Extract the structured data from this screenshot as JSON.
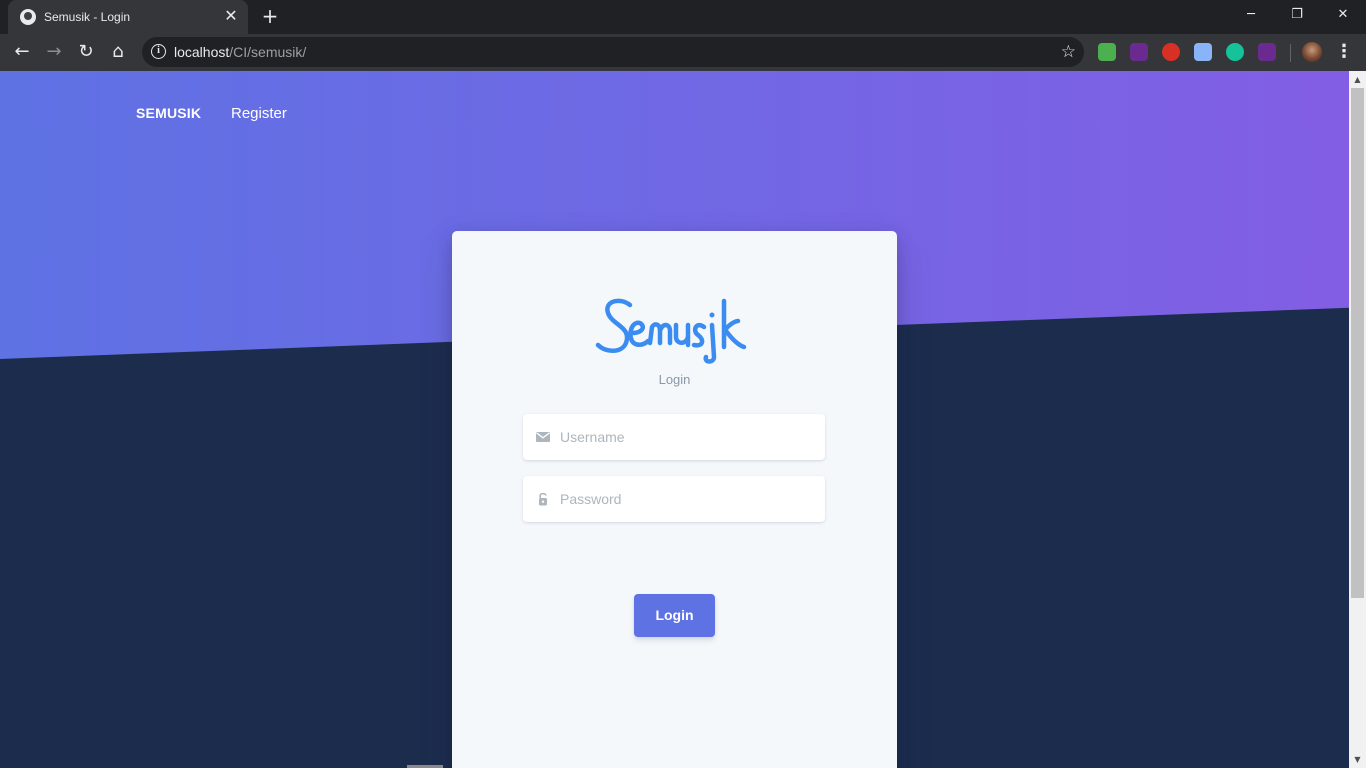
{
  "browser": {
    "tab_title": "Semusik - Login",
    "tab_close": "✕",
    "new_tab": "+",
    "url_host": "localhost",
    "url_path": "/CI/semusik/",
    "window": {
      "minimize": "─",
      "restore": "❐",
      "close": "✕"
    },
    "nav": {
      "back": "←",
      "forward": "→",
      "reload": "↻",
      "home": "⌂"
    },
    "star": "☆",
    "menu": "⋮",
    "extensions": [
      {
        "name": "ext-green-globe",
        "color": "#4caf50"
      },
      {
        "name": "ext-purple-x",
        "color": "#6b2a8f"
      },
      {
        "name": "ext-red-stop",
        "color": "#d93025"
      },
      {
        "name": "ext-owl",
        "color": "#8ab4f8"
      },
      {
        "name": "ext-grammarly",
        "color": "#15c39a"
      },
      {
        "name": "ext-purple-x-2",
        "color": "#6b2a8f"
      }
    ]
  },
  "navbar": {
    "brand": "SEMUSIK",
    "register": "Register"
  },
  "card": {
    "subtitle": "Login",
    "username_placeholder": "Username",
    "password_placeholder": "Password",
    "login_button": "Login"
  },
  "colors": {
    "primary": "#5e72e4",
    "gradient_end": "#825ee4",
    "dark_bg": "#1b2c4d",
    "logo": "#3b8cf0"
  }
}
